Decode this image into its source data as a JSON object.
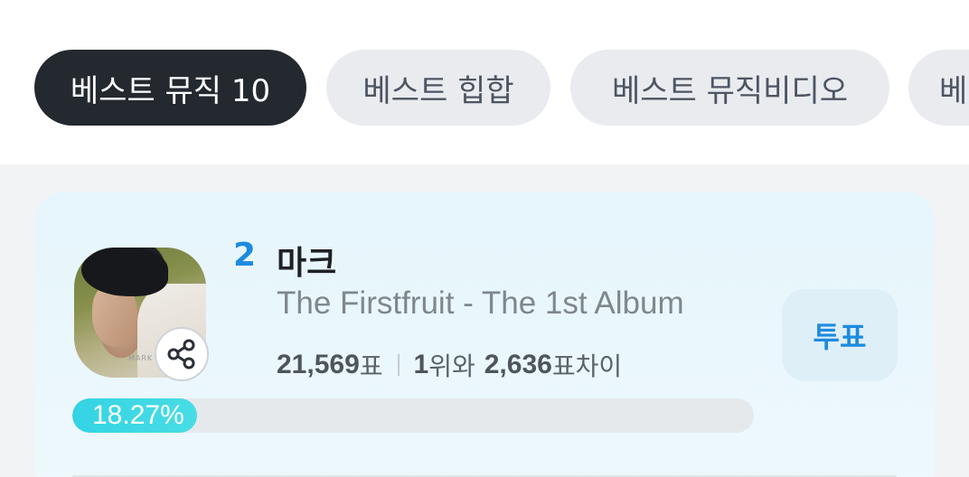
{
  "tabs": [
    {
      "label": "베스트 뮤직 10",
      "active": true
    },
    {
      "label": "베스트 힙합",
      "active": false
    },
    {
      "label": "베스트 뮤직비디오",
      "active": false
    },
    {
      "label": "베",
      "active": false
    }
  ],
  "entry": {
    "rank": "2",
    "artist": "마크",
    "album": "The Firstfruit - The 1st Album",
    "votes": "21,569",
    "votes_unit": "표",
    "lead_rank": "1",
    "lead_suffix": "위와",
    "gap": "2,636",
    "gap_suffix": "표차이",
    "percent_label": "18.27%",
    "percent": 18.27,
    "vote_button": "투표",
    "thumbnail_watermark": "MARK"
  },
  "icons": {
    "share": "share-icon"
  },
  "colors": {
    "active_tab": "#23292f",
    "accent": "#1d8be0",
    "progress": "#3fd8e4"
  }
}
